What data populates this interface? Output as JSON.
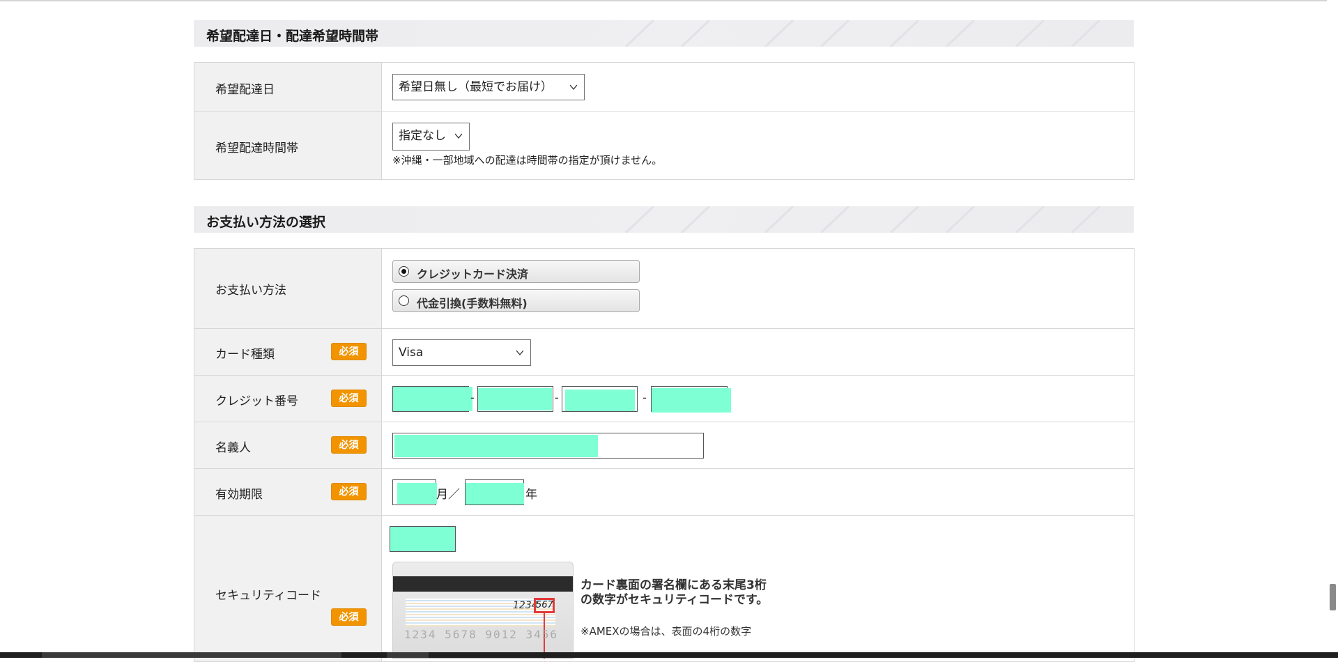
{
  "delivery": {
    "section_title": "希望配達日・配達希望時間帯",
    "date_label": "希望配達日",
    "date_select": "希望日無し（最短でお届け）",
    "time_label": "希望配達時間帯",
    "time_select": "指定なし",
    "time_note": "※沖縄・一部地域への配達は時間帯の指定が頂けません。"
  },
  "payment": {
    "section_title": "お支払い方法の選択",
    "method_label": "お支払い方法",
    "options": [
      {
        "label": "クレジットカード決済",
        "checked": true
      },
      {
        "label": "代金引換(手数料無料)",
        "checked": false
      }
    ],
    "required_badge": "必須",
    "card_type_label": "カード種類",
    "card_type_select": "Visa",
    "card_number_label": "クレジット番号",
    "dash": "-",
    "holder_label": "名義人",
    "expiry_label": "有効期限",
    "month_unit": "月／",
    "year_unit": "年",
    "security_label": "セキュリティコード",
    "security_desc_line1": "カード裏面の署名欄にある末尾3桁",
    "security_desc_line2": "の数字がセキュリティコードです。",
    "security_note": "※AMEXの場合は、表面の4桁の数字",
    "card_image": {
      "sig_number": "1234",
      "cvv": "567",
      "card_number": "1234 5678 9012 3456"
    }
  },
  "colors": {
    "required": "#f29400",
    "mask": "#7fffd4"
  }
}
